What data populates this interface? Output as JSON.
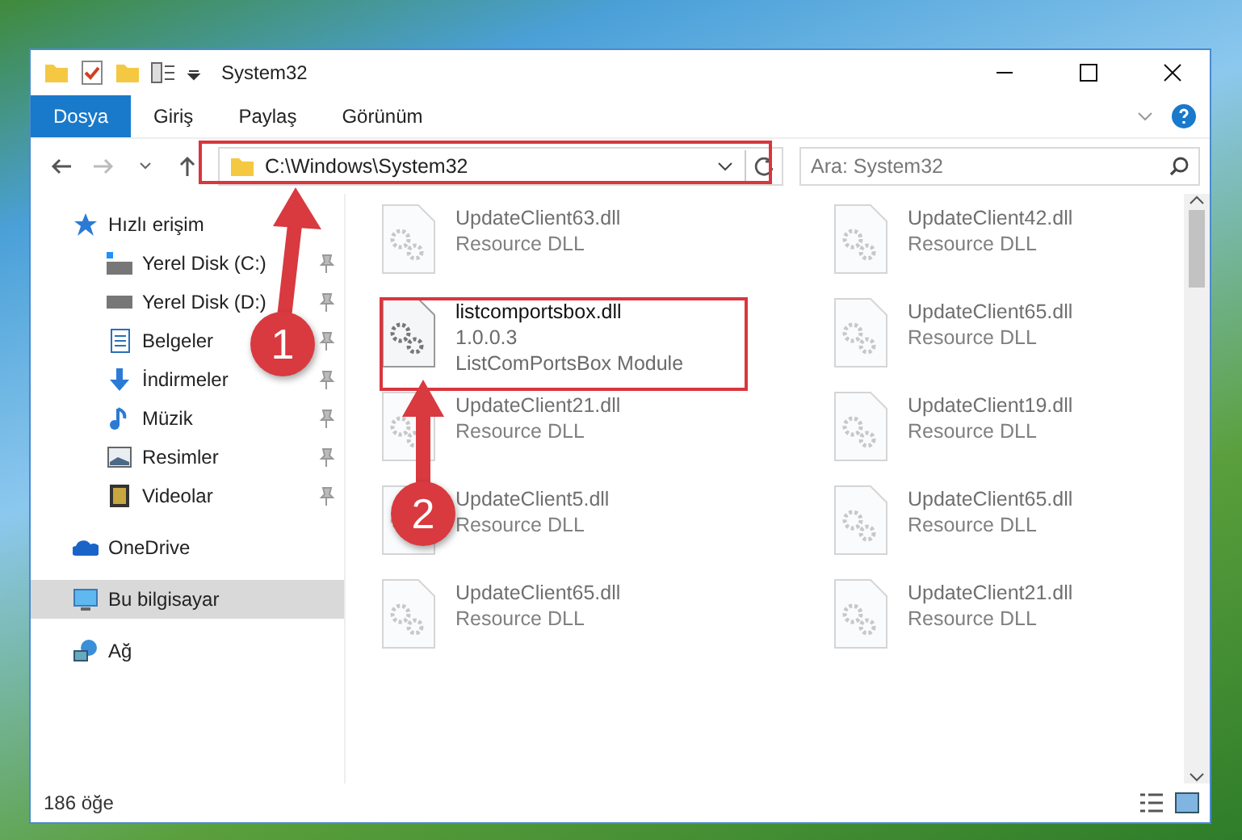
{
  "window": {
    "title": "System32"
  },
  "ribbon_tabs": [
    {
      "label": "Dosya",
      "selected": true
    },
    {
      "label": "Giriş",
      "selected": false
    },
    {
      "label": "Paylaş",
      "selected": false
    },
    {
      "label": "Görünüm",
      "selected": false
    }
  ],
  "address_bar": {
    "path": "C:\\Windows\\System32"
  },
  "search": {
    "placeholder": "Ara: System32"
  },
  "navigation": [
    {
      "label": "Hızlı erişim",
      "kind": "star",
      "selected": false,
      "children": [
        {
          "label": "Yerel Disk (C:)",
          "kind": "system-drive",
          "pinned": true,
          "selected": false
        },
        {
          "label": "Yerel Disk (D:)",
          "kind": "drive",
          "pinned": true,
          "selected": false
        },
        {
          "label": "Belgeler",
          "kind": "documents",
          "pinned": true,
          "selected": false
        },
        {
          "label": "İndirmeler",
          "kind": "downloads",
          "pinned": true,
          "selected": false
        },
        {
          "label": "Müzik",
          "kind": "music",
          "pinned": true,
          "selected": false
        },
        {
          "label": "Resimler",
          "kind": "pictures",
          "pinned": true,
          "selected": false
        },
        {
          "label": "Videolar",
          "kind": "videos",
          "pinned": true,
          "selected": false
        }
      ]
    },
    {
      "label": "OneDrive",
      "kind": "cloud",
      "selected": false
    },
    {
      "label": "Bu bilgisayar",
      "kind": "computer",
      "selected": true
    },
    {
      "label": "Ağ",
      "kind": "network",
      "selected": false
    }
  ],
  "files": [
    {
      "name": "UpdateClient63.dll",
      "details": [
        "Resource DLL"
      ],
      "faded": true
    },
    {
      "name": "UpdateClient42.dll",
      "details": [
        "Resource DLL"
      ],
      "faded": true
    },
    {
      "name": "listcomportsbox.dll",
      "details": [
        "1.0.0.3",
        "ListComPortsBox Module"
      ],
      "faded": false
    },
    {
      "name": "UpdateClient65.dll",
      "details": [
        "Resource DLL"
      ],
      "faded": true
    },
    {
      "name": "UpdateClient21.dll",
      "details": [
        "Resource DLL"
      ],
      "faded": true
    },
    {
      "name": "UpdateClient19.dll",
      "details": [
        "Resource DLL"
      ],
      "faded": true
    },
    {
      "name": "UpdateClient5.dll",
      "details": [
        "Resource DLL"
      ],
      "faded": true
    },
    {
      "name": "UpdateClient65.dll",
      "details": [
        "Resource DLL"
      ],
      "faded": true
    },
    {
      "name": "UpdateClient65.dll",
      "details": [
        "Resource DLL"
      ],
      "faded": true
    },
    {
      "name": "UpdateClient21.dll",
      "details": [
        "Resource DLL"
      ],
      "faded": true
    }
  ],
  "status_bar": {
    "item_count": "186 öğe"
  },
  "callouts": [
    {
      "number": "1"
    },
    {
      "number": "2"
    }
  ]
}
